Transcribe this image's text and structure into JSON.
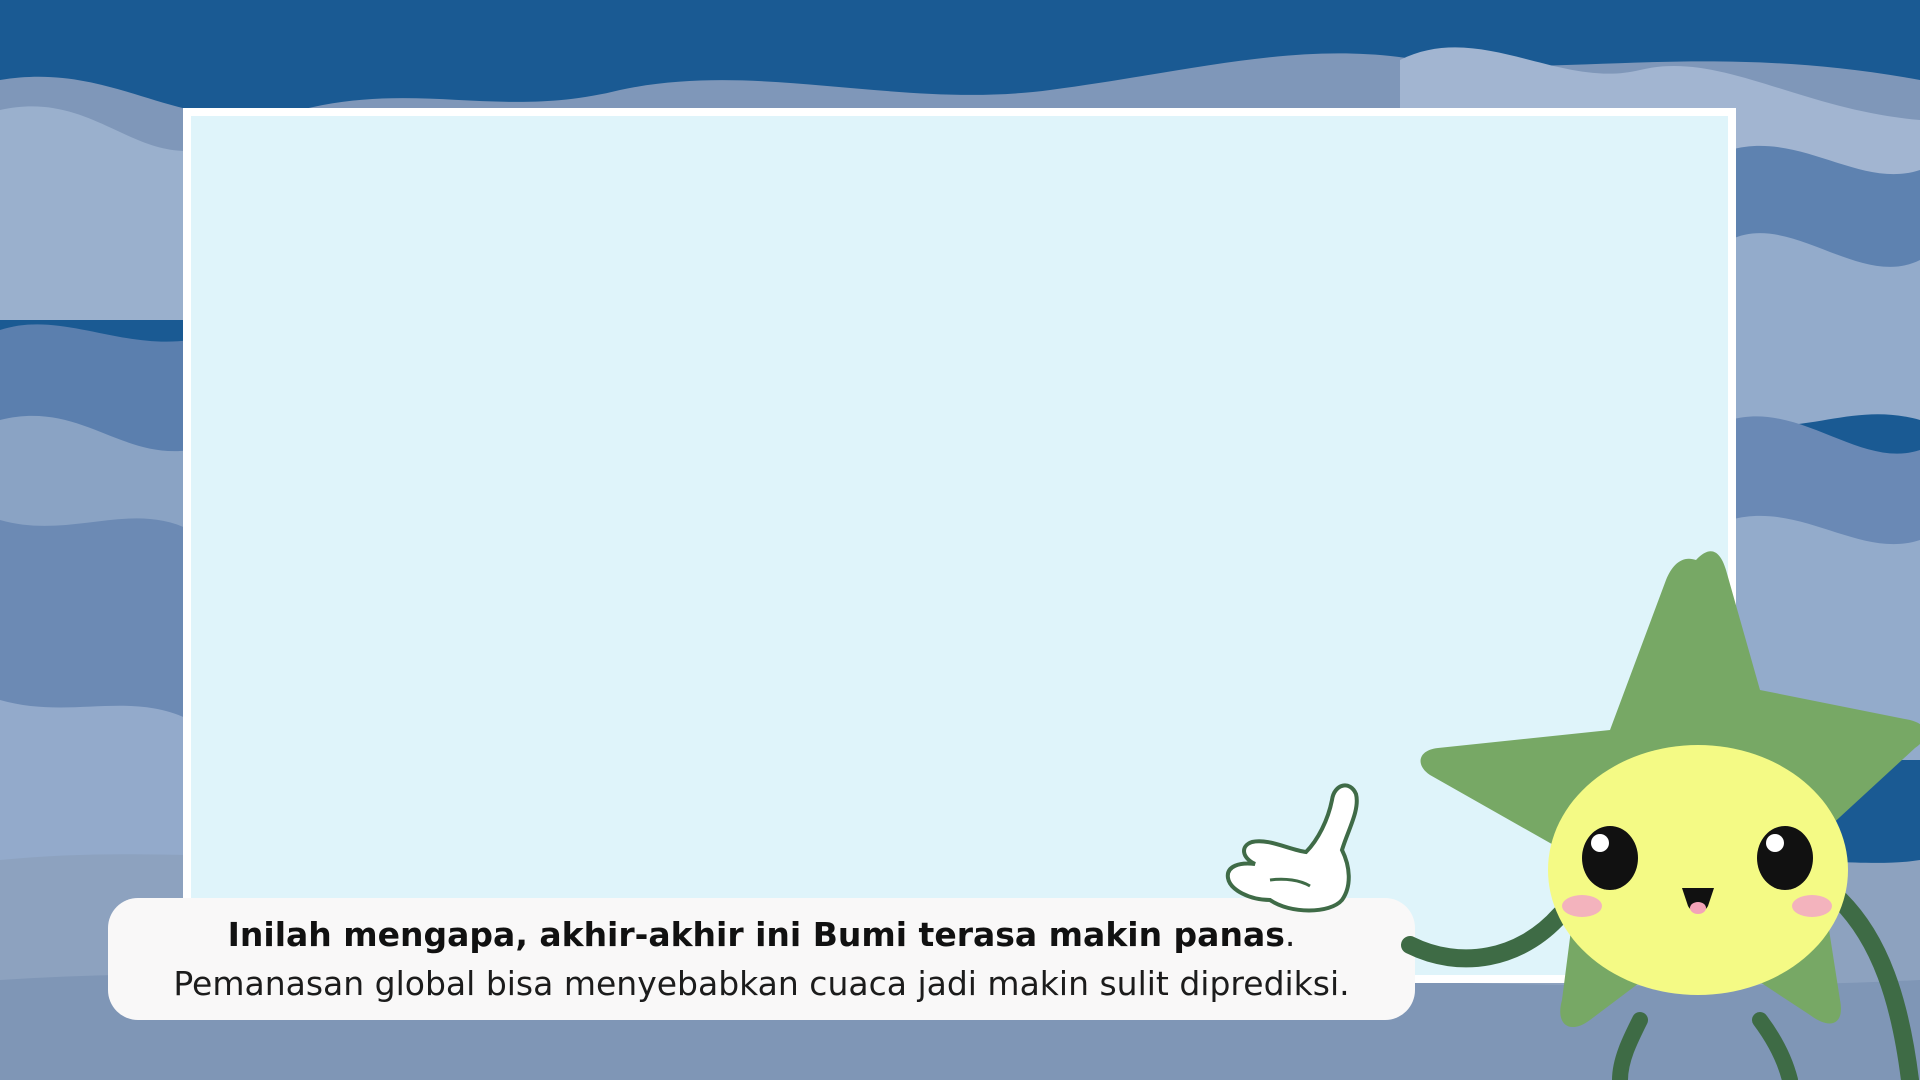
{
  "caption": {
    "bold": "Inilah mengapa, akhir-akhir ini Bumi terasa makin panas",
    "regular": ". Pemanasan global bisa menyebabkan cuaca jadi makin sulit diprediksi."
  },
  "colors": {
    "sky_dark": "#1a5a93",
    "cloud_light": "#8fa6c5",
    "panel": "#dff4fa",
    "caption_bg": "#f9f8f8",
    "star_green": "#77a865",
    "face_yellow": "#f4fa85",
    "cheek_pink": "#f3b3bd"
  },
  "icons": {
    "mascot": "star-mascot-icon",
    "hand": "pointing-hand-icon"
  }
}
